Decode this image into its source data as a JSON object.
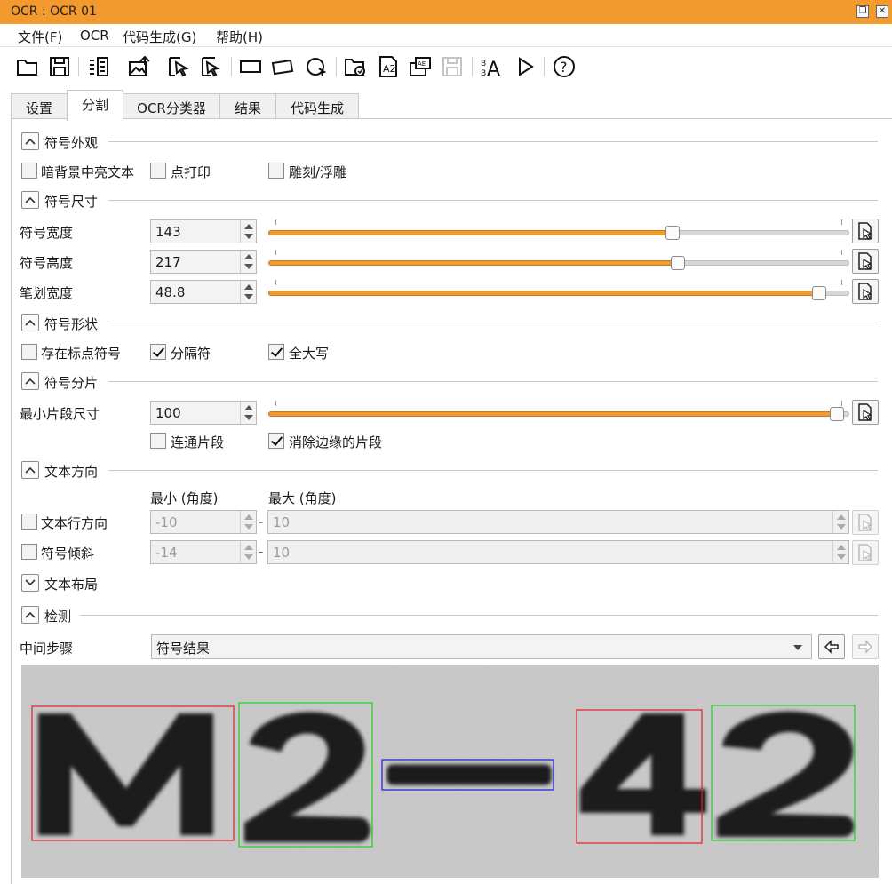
{
  "window": {
    "title": "OCR : OCR 01",
    "restore_icon": "restore-icon",
    "close_icon": "close-icon"
  },
  "menu": {
    "file": "文件(F)",
    "ocr": "OCR",
    "codegen": "代码生成(G)",
    "help": "帮助(H)"
  },
  "toolbar": {
    "icons": [
      "open-folder-icon",
      "save-icon",
      "image-list-icon",
      "load-image-icon",
      "cut-select-icon",
      "cut-region-icon",
      "rectangle-icon",
      "rotated-rectangle-icon",
      "circle-region-icon",
      "folder-ocr-icon",
      "char-font-icon",
      "save-image-icon",
      "disabled-save-icon",
      "font-size-icon",
      "play-icon",
      "help-icon"
    ]
  },
  "tabs": {
    "settings": "设置",
    "segmentation": "分割",
    "ocr_classifier": "OCR分类器",
    "results": "结果",
    "code_generation": "代码生成"
  },
  "sections": {
    "appearance": {
      "title": "符号外观",
      "light_on_dark": "暗背景中亮文本",
      "dot_print": "点打印",
      "engraved": "雕刻/浮雕",
      "light_on_dark_checked": false,
      "dot_print_checked": false,
      "engraved_checked": false
    },
    "size": {
      "title": "符号尺寸",
      "width_label": "符号宽度",
      "width_value": "143",
      "width_fraction": 0.7,
      "height_label": "符号高度",
      "height_value": "217",
      "height_fraction": 0.71,
      "stroke_label": "笔划宽度",
      "stroke_value": "48.8",
      "stroke_fraction": 0.96
    },
    "shape": {
      "title": "符号形状",
      "punctuation": "存在标点符号",
      "punctuation_checked": false,
      "separator": "分隔符",
      "separator_checked": true,
      "uppercase": "全大写",
      "uppercase_checked": true
    },
    "fragment": {
      "title": "符号分片",
      "min_label": "最小片段尺寸",
      "min_value": "100",
      "min_fraction": 0.99,
      "connected": "连通片段",
      "connected_checked": false,
      "remove_border": "消除边缘的片段",
      "remove_border_checked": true
    },
    "orientation": {
      "title": "文本方向",
      "min_header": "最小 (角度)",
      "max_header": "最大 (角度)",
      "line_label": "文本行方向",
      "line_min": "-10",
      "line_max": "10",
      "slant_label": "符号倾斜",
      "slant_min": "-14",
      "slant_max": "10",
      "dash": "-"
    },
    "layout": {
      "title": "文本布局"
    },
    "detection": {
      "title": "检测",
      "step_label": "中间步骤",
      "step_value": "符号结果"
    }
  },
  "colors": {
    "accent": "#f29a2e",
    "box_red": "#e0202a",
    "box_green": "#22d022",
    "box_blue": "#1a1ad8"
  }
}
